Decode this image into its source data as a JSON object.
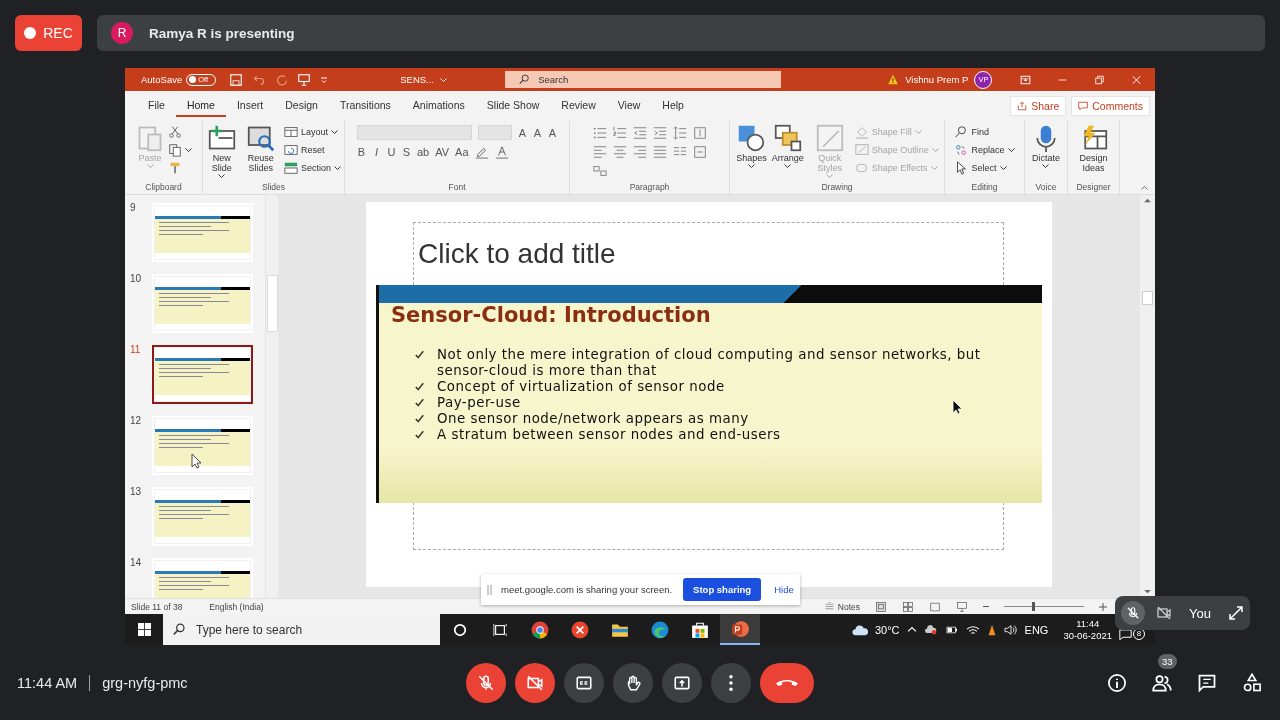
{
  "meet": {
    "recording": {
      "label": "REC"
    },
    "presenter": {
      "initial": "R",
      "text": "Ramya R is presenting"
    },
    "share_banner": {
      "text": "meet.google.com is sharing your screen.",
      "stop_button": "Stop sharing",
      "hide_link": "Hide"
    },
    "self_view": {
      "name": "You"
    },
    "time": "11:44 AM",
    "meeting_code": "grg-nyfg-pmc",
    "controls": [
      {
        "kind": "mic",
        "on": false
      },
      {
        "kind": "camera",
        "on": false
      },
      {
        "kind": "captions",
        "on": false
      },
      {
        "kind": "hand"
      },
      {
        "kind": "present"
      },
      {
        "kind": "more"
      },
      {
        "kind": "leave"
      }
    ],
    "side_buttons": [
      {
        "kind": "info"
      },
      {
        "kind": "people",
        "badge": "33"
      },
      {
        "kind": "chat"
      },
      {
        "kind": "activities"
      }
    ]
  },
  "powerpoint": {
    "title_bar": {
      "autosave_label": "AutoSave",
      "autosave": {
        "on": false,
        "label": "Off"
      },
      "file_name": "SENS...",
      "search_placeholder": "Search",
      "user_name": "Vishnu Prem P",
      "user_initials": "VP"
    },
    "tabs": [
      {
        "label": "File",
        "selected": false
      },
      {
        "label": "Home",
        "selected": true
      },
      {
        "label": "Insert",
        "selected": false
      },
      {
        "label": "Design",
        "selected": false
      },
      {
        "label": "Transitions",
        "selected": false
      },
      {
        "label": "Animations",
        "selected": false
      },
      {
        "label": "Slide Show",
        "selected": false
      },
      {
        "label": "Review",
        "selected": false
      },
      {
        "label": "View",
        "selected": false
      },
      {
        "label": "Help",
        "selected": false
      }
    ],
    "share_button": "Share",
    "comments_button": "Comments",
    "ribbon": [
      {
        "name": "Clipboard",
        "kind": "buttons",
        "items": [
          {
            "kind": "paste",
            "large": true,
            "label": "Paste",
            "disabled": true,
            "menu": true
          },
          {
            "kind": "cut",
            "large": false
          },
          {
            "kind": "copy",
            "large": false,
            "menu": true
          },
          {
            "kind": "painter",
            "large": false
          }
        ]
      },
      {
        "name": "Slides",
        "kind": "buttons",
        "items": [
          {
            "kind": "new_slide",
            "large": true,
            "label": "New Slide",
            "menu": true
          },
          {
            "kind": "reuse",
            "large": true,
            "label": "Reuse Slides"
          },
          {
            "kind": "layout",
            "large": false,
            "label": "Layout",
            "menu": true
          },
          {
            "kind": "reset",
            "large": false,
            "label": "Reset"
          },
          {
            "kind": "section",
            "large": false,
            "label": "Section",
            "menu": true
          }
        ]
      },
      {
        "name": "Font",
        "kind": "rows",
        "rows": [
          [
            {
              "kind": "combo",
              "wide": true,
              "disabled": true
            },
            {
              "kind": "combo",
              "wide": false,
              "disabled": true
            },
            {
              "kind": "glyph",
              "label": "A"
            },
            {
              "kind": "glyph",
              "label": "A"
            },
            {
              "kind": "glyph",
              "label": "A"
            }
          ],
          [
            {
              "kind": "glyph",
              "label": "B"
            },
            {
              "kind": "glyph",
              "label": "I"
            },
            {
              "kind": "glyph",
              "label": "U"
            },
            {
              "kind": "glyph",
              "label": "S"
            },
            {
              "kind": "glyph",
              "label": "ab"
            },
            {
              "kind": "glyph",
              "label": "AV"
            },
            {
              "kind": "glyph",
              "label": "Aa"
            },
            {
              "kind": "highlight"
            },
            {
              "kind": "font_color"
            }
          ]
        ]
      },
      {
        "name": "Paragraph",
        "kind": "rows",
        "rows": [
          [
            {
              "kind": "bullets"
            },
            {
              "kind": "numbering"
            },
            {
              "kind": "indent_less"
            },
            {
              "kind": "indent_more"
            },
            {
              "kind": "line_spacing"
            },
            {
              "kind": "text_direction"
            }
          ],
          [
            {
              "kind": "align_left"
            },
            {
              "kind": "align_center"
            },
            {
              "kind": "align_right"
            },
            {
              "kind": "justify"
            },
            {
              "kind": "columns"
            },
            {
              "kind": "align_text"
            }
          ],
          [
            {
              "kind": "smartart"
            }
          ]
        ]
      },
      {
        "name": "Drawing",
        "kind": "buttons",
        "items": [
          {
            "kind": "shapes",
            "large": true,
            "label": "Shapes",
            "menu": true
          },
          {
            "kind": "arrange",
            "large": true,
            "label": "Arrange",
            "menu": true
          },
          {
            "kind": "quick_styles",
            "large": true,
            "label": "Quick Styles",
            "disabled": true,
            "menu": true
          },
          {
            "kind": "shape_fill",
            "large": false,
            "label": "Shape Fill",
            "disabled": true,
            "menu": true
          },
          {
            "kind": "shape_outline",
            "large": false,
            "label": "Shape Outline",
            "disabled": true,
            "menu": true
          },
          {
            "kind": "shape_effects",
            "large": false,
            "label": "Shape Effects",
            "disabled": true,
            "menu": true
          }
        ]
      },
      {
        "name": "Editing",
        "kind": "buttons",
        "items": [
          {
            "kind": "find",
            "large": false,
            "label": "Find"
          },
          {
            "kind": "replace",
            "large": false,
            "label": "Replace",
            "menu": true
          },
          {
            "kind": "select",
            "large": false,
            "label": "Select",
            "menu": true
          }
        ]
      },
      {
        "name": "Voice",
        "kind": "buttons",
        "items": [
          {
            "kind": "dictate",
            "large": true,
            "label": "Dictate",
            "menu": true
          }
        ]
      },
      {
        "name": "Designer",
        "kind": "buttons",
        "items": [
          {
            "kind": "design_ideas",
            "large": true,
            "label": "Design Ideas"
          }
        ]
      }
    ],
    "thumbnails": [
      {
        "number": "9",
        "selected": false
      },
      {
        "number": "10",
        "selected": false
      },
      {
        "number": "11",
        "selected": true
      },
      {
        "number": "12",
        "selected": false
      },
      {
        "number": "13",
        "selected": false
      },
      {
        "number": "14",
        "selected": false
      }
    ],
    "slide": {
      "title_placeholder": "Click to add title",
      "heading": "Sensor-Cloud: Introduction",
      "bullets": [
        "Not only the mere integration of cloud computing and sensor networks, but sensor-cloud is more than that",
        "Concept of virtualization of sensor node",
        "Pay-per-use",
        "One sensor node/network appears as many",
        "A stratum between sensor nodes and end-users"
      ]
    },
    "status_bar": {
      "slide_info": "Slide 11 of 38",
      "language": "English (India)",
      "notes": "Notes",
      "zoom": {
        "level": 0.35
      }
    }
  },
  "taskbar": {
    "search_placeholder": "Type here to search",
    "apps": [
      {
        "kind": "chrome",
        "active": false
      },
      {
        "kind": "remote",
        "active": false
      },
      {
        "kind": "folder",
        "active": false
      },
      {
        "kind": "edge",
        "active": false
      },
      {
        "kind": "store",
        "active": false
      },
      {
        "kind": "powerpoint",
        "active": true
      }
    ],
    "temperature": "30°C",
    "language": "ENG",
    "time": "11:44",
    "date": "30-06-2021",
    "notification_count": "8"
  }
}
